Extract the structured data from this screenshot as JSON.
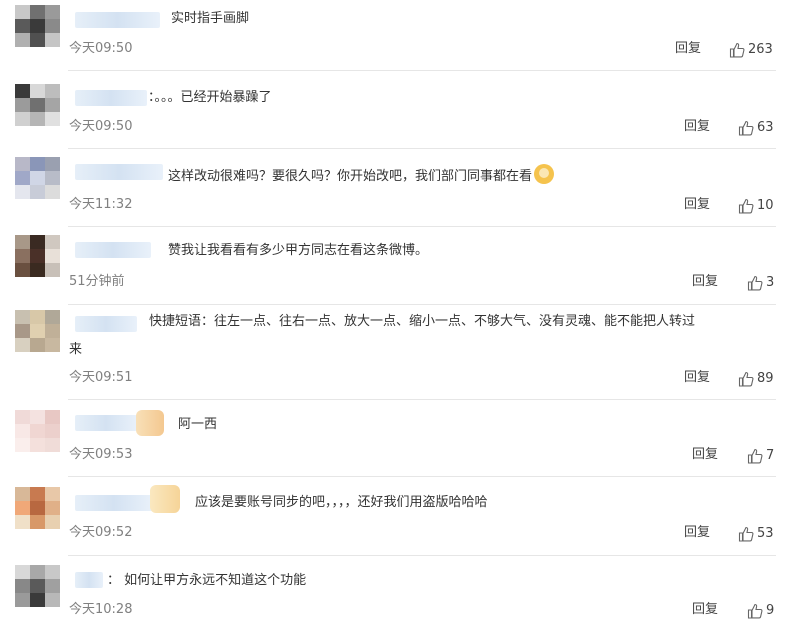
{
  "comments": [
    {
      "text": "实时指手画脚",
      "time": "今天09:50",
      "reply": "回复",
      "likes": "263"
    },
    {
      "text": "：。。。已经开始暴躁了",
      "time": "今天09:50",
      "reply": "回复",
      "likes": "63"
    },
    {
      "text": "这样改动很难吗？要很久吗？你开始改吧，我们部门同事都在看",
      "emoji": "doge-emoji",
      "time": "今天11:32",
      "reply": "回复",
      "likes": "10"
    },
    {
      "text": "赞我让我看看有多少甲方同志在看这条微博。",
      "time": "51分钟前",
      "reply": "回复",
      "likes": "3"
    },
    {
      "text": "快捷短语：往左一点、往右一点、放大一点、缩小一点、不够大气、没有灵魂、能不能把人转过",
      "text2": "来",
      "time": "今天09:51",
      "reply": "回复",
      "likes": "89"
    },
    {
      "text": "阿一西",
      "time": "今天09:53",
      "reply": "回复",
      "likes": "7"
    },
    {
      "text": "应该是要账号同步的吧，，，，还好我们用盗版哈哈哈",
      "time": "今天09:52",
      "reply": "回复",
      "likes": "53"
    },
    {
      "text": "：  如何让甲方永远不知道这个功能",
      "time": "今天10:28",
      "reply": "回复",
      "likes": "9"
    }
  ],
  "icons": {
    "like": "thumbs-up-icon"
  },
  "colors": {
    "time": "#808080",
    "separator": "#e6e6e6"
  }
}
